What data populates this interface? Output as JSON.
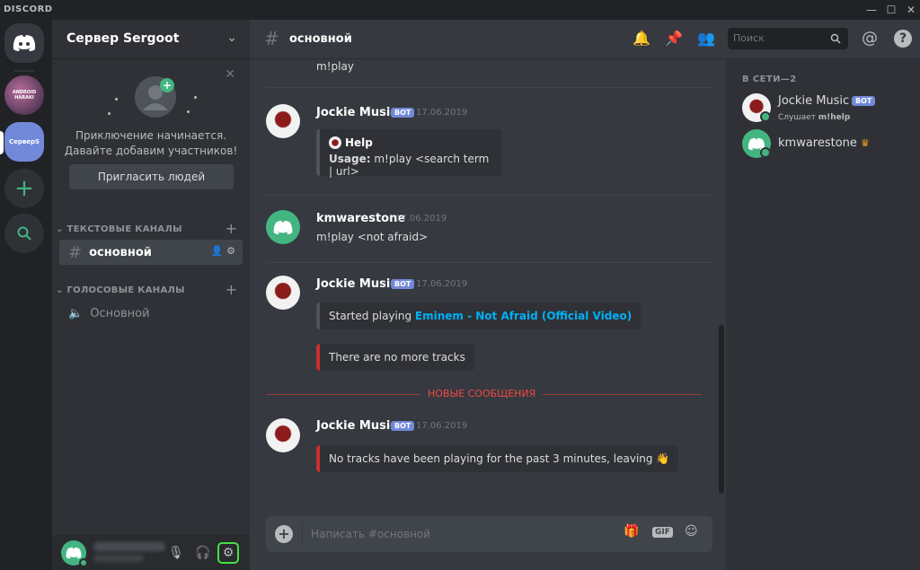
{
  "app": {
    "brand": "DISCORD",
    "minimize": "—",
    "maximize": "☐",
    "close": "✕"
  },
  "servers": [
    {
      "name": "home",
      "label": ""
    },
    {
      "name": "android",
      "label": "ANDROID HARAKI"
    },
    {
      "name": "servers",
      "label": "СерверS"
    },
    {
      "name": "add",
      "label": "+"
    },
    {
      "name": "explore",
      "label": ""
    }
  ],
  "guild": {
    "name": "Сервер Sergoot"
  },
  "invite": {
    "text_line1": "Приключение начинается.",
    "text_line2": "Давайте добавим участников!",
    "button": "Пригласить людей"
  },
  "categories": {
    "text": "ТЕКСТОВЫЕ КАНАЛЫ",
    "voice": "ГОЛОСОВЫЕ КАНАЛЫ"
  },
  "channels": {
    "text_active": "основной",
    "voice": "Основной"
  },
  "header": {
    "channel": "основной",
    "search_placeholder": "Поиск"
  },
  "messages": {
    "top_content": "m!play",
    "m1": {
      "author": "Jockie Music",
      "bot": "BOT",
      "time": "17.06.2019",
      "embed_title": "Help",
      "embed_usage_label": "Usage:",
      "embed_usage_value": "m!play <search term | url>"
    },
    "m2": {
      "author": "kmwarestone",
      "time": "17.06.2019",
      "content": "m!play <not afraid>"
    },
    "m3": {
      "author": "Jockie Music",
      "bot": "BOT",
      "time": "17.06.2019",
      "embed1_prefix": "Started playing",
      "embed1_link": "Eminem - Not Afraid (Official Video)",
      "embed2": "There are no more tracks"
    },
    "new_messages": "НОВЫЕ СООБЩЕНИЯ",
    "m4": {
      "author": "Jockie Music",
      "bot": "BOT",
      "time": "17.06.2019",
      "embed": "No tracks have been playing for the past 3 minutes, leaving",
      "emoji": "👋"
    }
  },
  "input": {
    "placeholder": "Написать #основной",
    "gif": "GIF"
  },
  "members": {
    "category": "В СЕТИ—2",
    "list": [
      {
        "name": "Jockie Music",
        "bot": "BOT",
        "activity_prefix": "Слушает",
        "activity_bold": "m!help"
      },
      {
        "name": "kmwarestone",
        "crown": "♛"
      }
    ]
  },
  "colors": {
    "accent": "#7289da",
    "online": "#43b581",
    "new_messages": "#f04747",
    "link": "#00b0f4"
  }
}
